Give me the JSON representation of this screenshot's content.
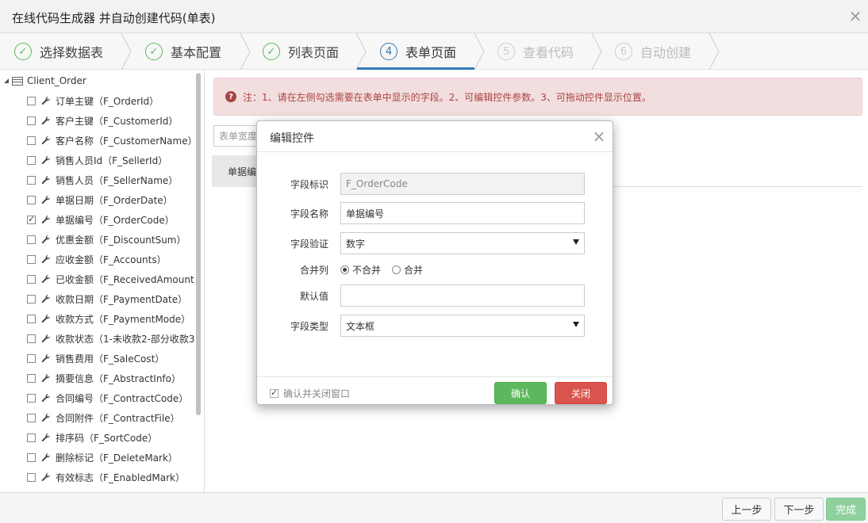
{
  "window": {
    "title": "在线代码生成器 并自动创建代码(单表)",
    "close": "×"
  },
  "steps": [
    {
      "num": "✓",
      "label": "选择数据表",
      "state": "done"
    },
    {
      "num": "✓",
      "label": "基本配置",
      "state": "done"
    },
    {
      "num": "✓",
      "label": "列表页面",
      "state": "done"
    },
    {
      "num": "4",
      "label": "表单页面",
      "state": "active"
    },
    {
      "num": "5",
      "label": "查看代码",
      "state": "pending"
    },
    {
      "num": "6",
      "label": "自动创建",
      "state": "pending"
    }
  ],
  "tree": {
    "root": "Client_Order",
    "items": [
      {
        "label": "订单主键（F_OrderId）",
        "checked": false
      },
      {
        "label": "客户主键（F_CustomerId）",
        "checked": false
      },
      {
        "label": "客户名称（F_CustomerName）",
        "checked": false
      },
      {
        "label": "销售人员Id（F_SellerId）",
        "checked": false
      },
      {
        "label": "销售人员（F_SellerName）",
        "checked": false
      },
      {
        "label": "单据日期（F_OrderDate）",
        "checked": false
      },
      {
        "label": "单据编号（F_OrderCode）",
        "checked": true
      },
      {
        "label": "优惠金额（F_DiscountSum）",
        "checked": false
      },
      {
        "label": "应收金额（F_Accounts）",
        "checked": false
      },
      {
        "label": "已收金额（F_ReceivedAmount",
        "checked": false
      },
      {
        "label": "收款日期（F_PaymentDate）",
        "checked": false
      },
      {
        "label": "收款方式（F_PaymentMode）",
        "checked": false
      },
      {
        "label": "收款状态（1-未收款2-部分收款3",
        "checked": false
      },
      {
        "label": "销售费用（F_SaleCost）",
        "checked": false
      },
      {
        "label": "摘要信息（F_AbstractInfo）",
        "checked": false
      },
      {
        "label": "合同编号（F_ContractCode）",
        "checked": false
      },
      {
        "label": "合同附件（F_ContractFile）",
        "checked": false
      },
      {
        "label": "排序码（F_SortCode）",
        "checked": false
      },
      {
        "label": "删除标记（F_DeleteMark）",
        "checked": false
      },
      {
        "label": "有效标志（F_EnabledMark）",
        "checked": false
      }
    ]
  },
  "main": {
    "note": "注：1、请在左侧勾选需要在表单中显示的字段。2、可编辑控件参数。3、可拖动控件显示位置。",
    "form_width_placeholder": "表单宽度",
    "grid_cell": "单据编"
  },
  "modal": {
    "title": "编辑控件",
    "close": "×",
    "fields": {
      "field_id_label": "字段标识",
      "field_id_value": "F_OrderCode",
      "field_name_label": "字段名称",
      "field_name_value": "单据编号",
      "validation_label": "字段验证",
      "validation_value": "数字",
      "merge_label": "合并列",
      "merge_no": "不合并",
      "merge_yes": "合并",
      "default_label": "默认值",
      "default_value": "",
      "type_label": "字段类型",
      "type_value": "文本框"
    },
    "footer": {
      "confirm_close": "确认并关闭窗口",
      "ok": "确认",
      "cancel": "关闭"
    }
  },
  "footer": {
    "prev": "上一步",
    "next": "下一步",
    "finish": "完成"
  },
  "colors": {
    "primary": "#337ab7",
    "success": "#5cb85c",
    "danger": "#d9534f",
    "alert_bg": "#f2dede",
    "alert_text": "#a94442"
  }
}
